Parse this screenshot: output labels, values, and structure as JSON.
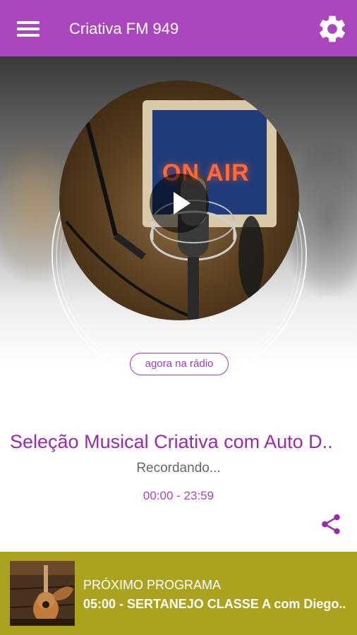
{
  "app": {
    "title": "Criativa FM 949",
    "colors": {
      "primary": "#ab47bc",
      "accent": "#9c27b0",
      "next_bar": "#aba220"
    }
  },
  "toolbar": {
    "menu_icon": "menu-icon",
    "settings_icon": "gear-icon"
  },
  "player": {
    "artwork_text": "ON AIR",
    "play_icon": "play-icon",
    "now_label": "agora na rádio",
    "program_title": "Seleção Musical Criativa com Auto D..",
    "program_subtitle": "Recordando...",
    "program_time": "00:00 - 23:59",
    "share_icon": "share-icon"
  },
  "next_program": {
    "label": "PRÓXIMO PROGRAMA",
    "title": "05:00 - SERTANEJO CLASSE A com Diego..",
    "thumbnail_icon": "guitar-thumbnail"
  }
}
